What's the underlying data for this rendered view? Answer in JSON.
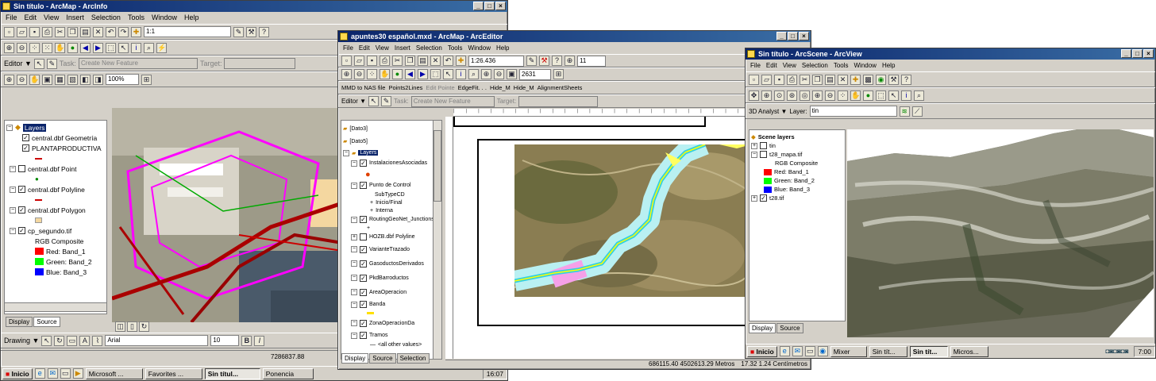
{
  "arcmap": {
    "title": "Sin título - ArcMap - ArcInfo",
    "menu": [
      "File",
      "Edit",
      "View",
      "Insert",
      "Selection",
      "Tools",
      "Window",
      "Help"
    ],
    "scale": "1:1",
    "editor_label": "Editor ▼",
    "task_label": "Task:",
    "task_value": "Create New Feature",
    "target_label": "Target:",
    "zoom_value": "100%",
    "layers_title": "Layers",
    "toc": [
      {
        "name": "central.dbf Geometría",
        "checked": true,
        "color": "#ff00ff"
      },
      {
        "name": "PLANTAPRODUCTIVA",
        "checked": true,
        "color": "#cc0000"
      },
      {
        "name": "central.dbf Point",
        "checked": false,
        "color": "#008000"
      },
      {
        "name": "central.dbf Polyline",
        "checked": true,
        "color": "#cc0000"
      },
      {
        "name": "central.dbf Polygon",
        "checked": true,
        "color": "#f4d7a0"
      }
    ],
    "raster_name": "cp_segundo.tif",
    "rgb_label": "RGB Composite",
    "bands": [
      {
        "label": "Red:  Band_1",
        "color": "#ff0000"
      },
      {
        "label": "Green: Band_2",
        "color": "#00ff00"
      },
      {
        "label": "Blue:  Band_3",
        "color": "#0000ff"
      }
    ],
    "tabs": [
      "Display",
      "Source"
    ],
    "drawing_label": "Drawing ▼",
    "font_name": "Arial",
    "font_size": "10",
    "bold": "B",
    "italic": "I",
    "coords": "7286837.88"
  },
  "arceditor": {
    "title": "apuntes30 español.mxd - ArcMap - ArcEditor",
    "menu": [
      "File",
      "Edit",
      "View",
      "Insert",
      "Selection",
      "Tools",
      "Window",
      "Help"
    ],
    "scale": "1:26.436",
    "zoom_value": "2631",
    "scale2": "11",
    "toolbar3": [
      "MMD to NAS file",
      "Points2Lines",
      "Edit Pointe",
      "EdgeFit. . .",
      "Hide_M",
      "Hide_M",
      "AlignmentSheets"
    ],
    "editor_label": "Editor ▼",
    "task_label": "Task:",
    "task_value": "Create New Feature",
    "target_label": "Target:",
    "toc": [
      {
        "name": "[Dato3]",
        "kind": "folder"
      },
      {
        "name": "[Dato5]",
        "kind": "folder"
      },
      {
        "name": "Layers",
        "kind": "layers"
      },
      {
        "name": "InstalacionesAsociadas",
        "kind": "layer"
      },
      {
        "name": "Punto de Control",
        "kind": "layer"
      },
      {
        "name": "SubTypeCD",
        "kind": "sub"
      },
      {
        "name": "Inicio/Final",
        "kind": "sub"
      },
      {
        "name": "Interna",
        "kind": "sub"
      },
      {
        "name": "RoutingGeoNet_Junctions",
        "kind": "layer"
      },
      {
        "name": "HOZB.dbf Polyline",
        "kind": "layer-off"
      },
      {
        "name": "VarianteTrazado",
        "kind": "layer"
      },
      {
        "name": "GasoductosDerivados",
        "kind": "layer"
      },
      {
        "name": "PkdBarroductos",
        "kind": "layer"
      },
      {
        "name": "AreaOperacion",
        "kind": "layer"
      },
      {
        "name": "Banda",
        "kind": "layer"
      },
      {
        "name": "ZonaOperacionDa",
        "kind": "layer"
      },
      {
        "name": "Tramos",
        "kind": "layer"
      },
      {
        "name": "<all other values>",
        "kind": "sub"
      }
    ],
    "tabs": [
      "Display",
      "Source",
      "Selection"
    ],
    "status": "686115.40  4502613.29 Metros",
    "status2": "17.32  1.24 Centímetros"
  },
  "arcscene": {
    "title": "Sin título - ArcScene - ArcView",
    "menu": [
      "File",
      "Edit",
      "View",
      "Selection",
      "Tools",
      "Window",
      "Help"
    ],
    "analyst_label": "3D Analyst ▼",
    "layer_label": "Layer:",
    "layer_value": "tin",
    "scene_layers_title": "Scene layers",
    "toc": [
      {
        "name": "tin",
        "checked": false
      },
      {
        "name": "t28_mapa.tif",
        "checked": false
      }
    ],
    "rgb_label": "RGB Composite",
    "bands": [
      {
        "label": "Red:   Band_1",
        "color": "#ff0000"
      },
      {
        "label": "Green: Band_2",
        "color": "#00ff00"
      },
      {
        "label": "Blue:  Band_3",
        "color": "#0000ff"
      }
    ],
    "last_layer": "t28.tif",
    "tabs": [
      "Display",
      "Source"
    ]
  },
  "taskbar_left": {
    "start": "Inicio",
    "buttons": [
      "Microsoft ...",
      "Favorites ...",
      "Sin títul...",
      "Ponencia"
    ],
    "time": "16:07"
  },
  "taskbar_right": {
    "start": "Inicio",
    "buttons": [
      "Mixer",
      "Sin tít...",
      "Sin tít...",
      "Micros..."
    ],
    "time": "7:00"
  }
}
